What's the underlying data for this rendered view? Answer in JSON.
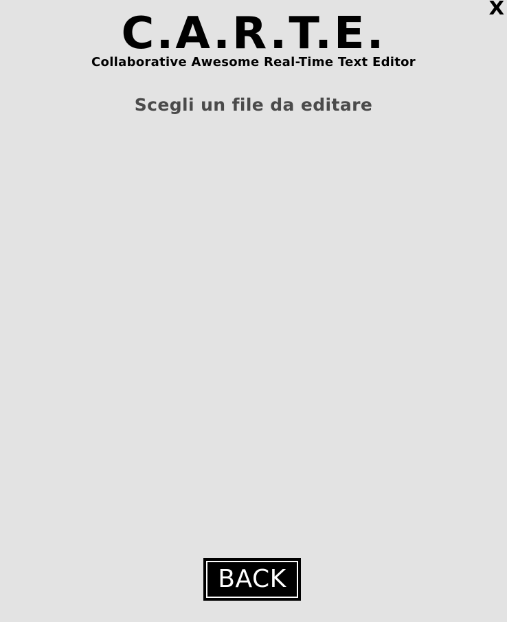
{
  "window": {
    "close_label": "X"
  },
  "header": {
    "title": "C.A.R.T.E.",
    "subtitle": "Collaborative Awesome Real-Time Text Editor"
  },
  "main": {
    "prompt": "Scegli un file da editare",
    "files": []
  },
  "footer": {
    "back_label": "BACK"
  }
}
